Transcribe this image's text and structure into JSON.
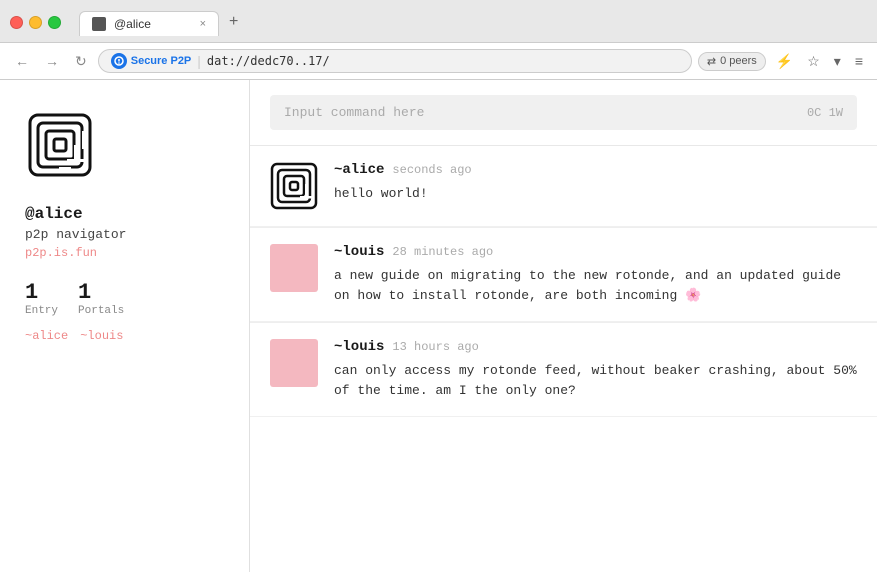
{
  "browser": {
    "tab_label": "@alice",
    "tab_close": "×",
    "tab_new": "+",
    "secure_label": "Secure P2P",
    "url": "dat://dedc70..17/",
    "peers": "0 peers",
    "nav_back": "←",
    "nav_forward": "→",
    "nav_reload": "↻",
    "menu_icon": "≡",
    "star_icon": "☆",
    "dropdown_icon": "▾",
    "bolt_icon": "⚡"
  },
  "sidebar": {
    "username": "@alice",
    "tagline": "p2p navigator",
    "site_link": "p2p.is.fun",
    "stats": [
      {
        "number": "1",
        "label": "Entry"
      },
      {
        "number": "1",
        "label": "Portals"
      }
    ],
    "following": [
      "~alice",
      "~louis"
    ]
  },
  "feed": {
    "command_placeholder": "Input command here",
    "command_hints": "0C 1W",
    "posts": [
      {
        "author": "~alice",
        "time": "seconds ago",
        "text": "hello world!",
        "avatar_type": "logo"
      },
      {
        "author": "~louis",
        "time": "28 minutes ago",
        "text": "a new guide on migrating to the new rotonde, and an updated guide on how to install rotonde, are both incoming 🌸",
        "avatar_type": "pink"
      },
      {
        "author": "~louis",
        "time": "13 hours ago",
        "text": "can only access my rotonde feed, without beaker crashing, about 50% of the time. am I the only one?",
        "avatar_type": "pink"
      }
    ]
  }
}
